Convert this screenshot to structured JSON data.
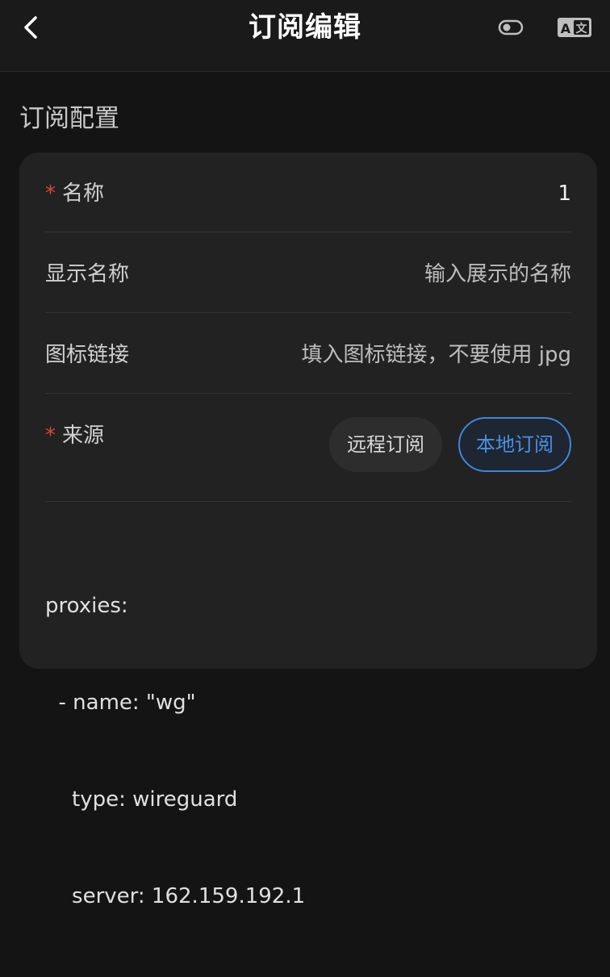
{
  "header": {
    "title": "订阅编辑",
    "icons": {
      "back": "chevron-left-icon",
      "toggle": "toggle-icon",
      "translate": "translate-icon"
    }
  },
  "section": {
    "title": "订阅配置"
  },
  "form": {
    "required_mark": "*",
    "name": {
      "label": "名称",
      "value": "1"
    },
    "display_name": {
      "label": "显示名称",
      "placeholder": "输入展示的名称"
    },
    "icon_link": {
      "label": "图标链接",
      "placeholder": "填入图标链接，不要使用 jpg"
    },
    "source": {
      "label": "来源",
      "options": [
        "远程订阅",
        "本地订阅"
      ],
      "selected": "本地订阅"
    }
  },
  "config_text": {
    "lines": [
      "proxies:",
      "  - name: \"wg\"",
      "    type: wireguard",
      "    server: 162.159.192.1"
    ]
  },
  "colors": {
    "accent": "#4a90e2",
    "required": "#e0453a",
    "card_bg": "#222222",
    "page_bg": "#141414"
  }
}
